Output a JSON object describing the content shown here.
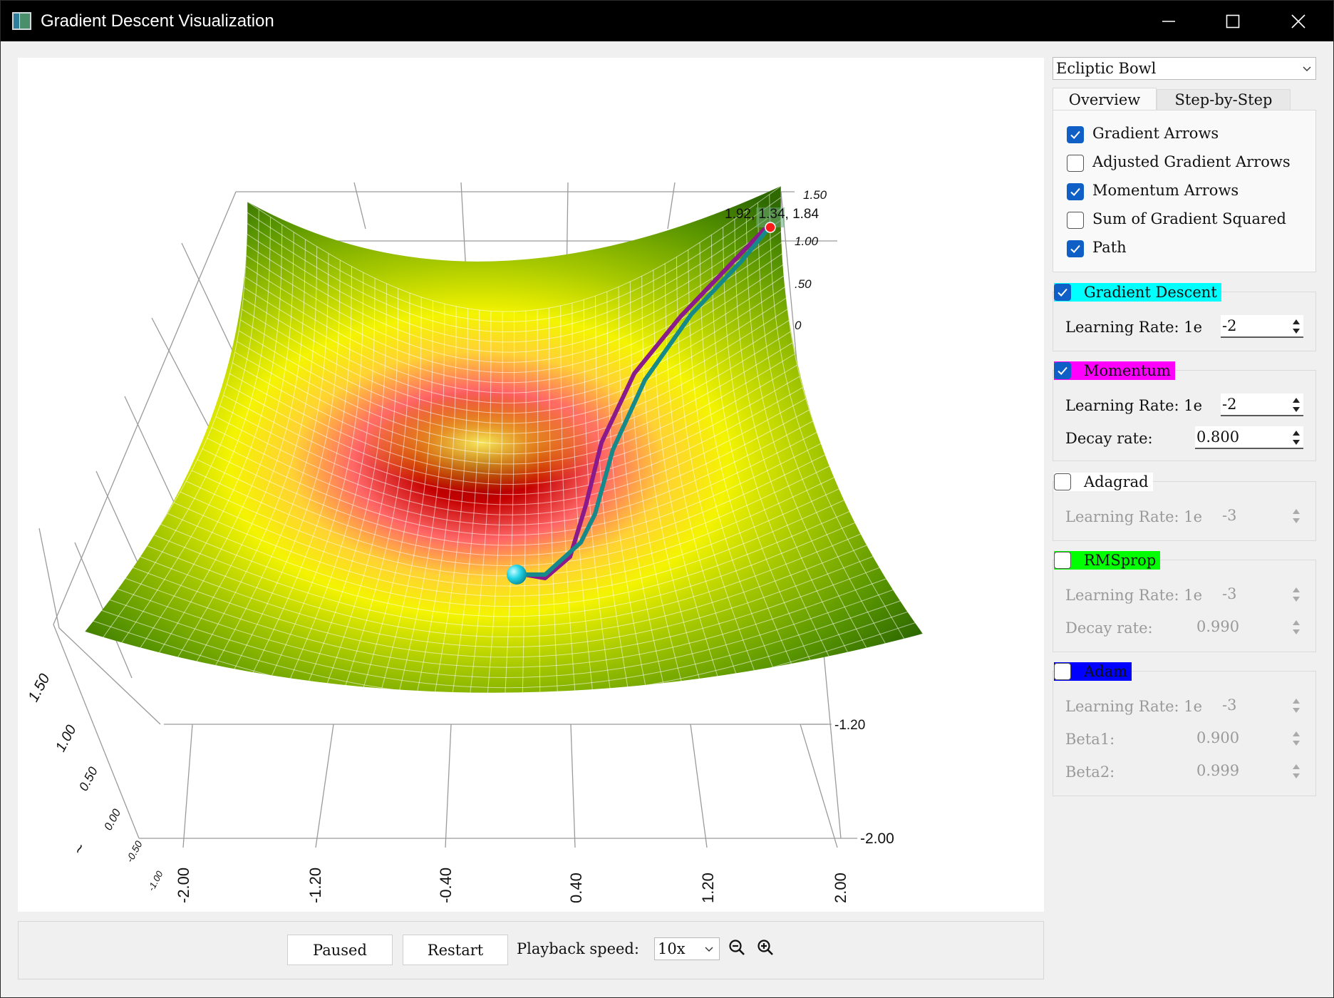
{
  "window": {
    "title": "Gradient Descent Visualization"
  },
  "plot": {
    "point_label": "1.92, 1.34, 1.84",
    "right_axis_ticks": [
      "1.50",
      "1.00",
      ".50",
      "0"
    ],
    "depth_ticks_right": [
      "-1.20",
      "-2.00"
    ],
    "bottom_ticks": [
      "-2.00",
      "-1.20",
      "-0.40",
      "0.40",
      "1.20",
      "2.00"
    ],
    "left_ticks": [
      "1.50",
      "1.00",
      "0.50",
      "0.00",
      "-0.50",
      "-1.00"
    ],
    "left_axis_fragment": "~",
    "colors": {
      "surface_low": "#b00000",
      "surface_mid": "#f2f200",
      "surface_high": "#3b7a00",
      "momentum_path": "#8b1a8b",
      "gd_path": "#168a8a",
      "ball": "#22d4e6",
      "start_point": "#ff1a1a"
    }
  },
  "controls": {
    "paused": "Paused",
    "restart": "Restart",
    "speed_label": "Playback speed:",
    "speed_value": "10x",
    "zoom_out_icon": "zoom-out-icon",
    "zoom_in_icon": "zoom-in-icon"
  },
  "sidebar": {
    "function_select": "Ecliptic Bowl",
    "tabs": [
      "Overview",
      "Step-by-Step"
    ],
    "options": [
      {
        "label": "Gradient Arrows",
        "checked": true
      },
      {
        "label": "Adjusted Gradient Arrows",
        "checked": false
      },
      {
        "label": "Momentum Arrows",
        "checked": true
      },
      {
        "label": "Sum of Gradient Squared",
        "checked": false
      },
      {
        "label": "Path",
        "checked": true
      }
    ],
    "optimizers": {
      "gd": {
        "name": "Gradient Descent",
        "color": "#00ffff",
        "checked": true,
        "lr_label": "Learning Rate: 1e",
        "lr": "-2"
      },
      "momentum": {
        "name": "Momentum",
        "color": "#ff00ff",
        "checked": true,
        "lr_label": "Learning Rate: 1e",
        "lr": "-2",
        "decay_label": "Decay rate:",
        "decay": "0.800"
      },
      "adagrad": {
        "name": "Adagrad",
        "color": "#ffffff",
        "checked": false,
        "lr_label": "Learning Rate: 1e",
        "lr": "-3"
      },
      "rmsprop": {
        "name": "RMSprop",
        "color": "#00ff00",
        "checked": false,
        "lr_label": "Learning Rate: 1e",
        "lr": "-3",
        "decay_label": "Decay rate:",
        "decay": "0.990"
      },
      "adam": {
        "name": "Adam",
        "color": "#0000ff",
        "checked": false,
        "lr_label": "Learning Rate: 1e",
        "lr": "-3",
        "beta1_label": "Beta1:",
        "beta1": "0.900",
        "beta2_label": "Beta2:",
        "beta2": "0.999"
      }
    }
  }
}
